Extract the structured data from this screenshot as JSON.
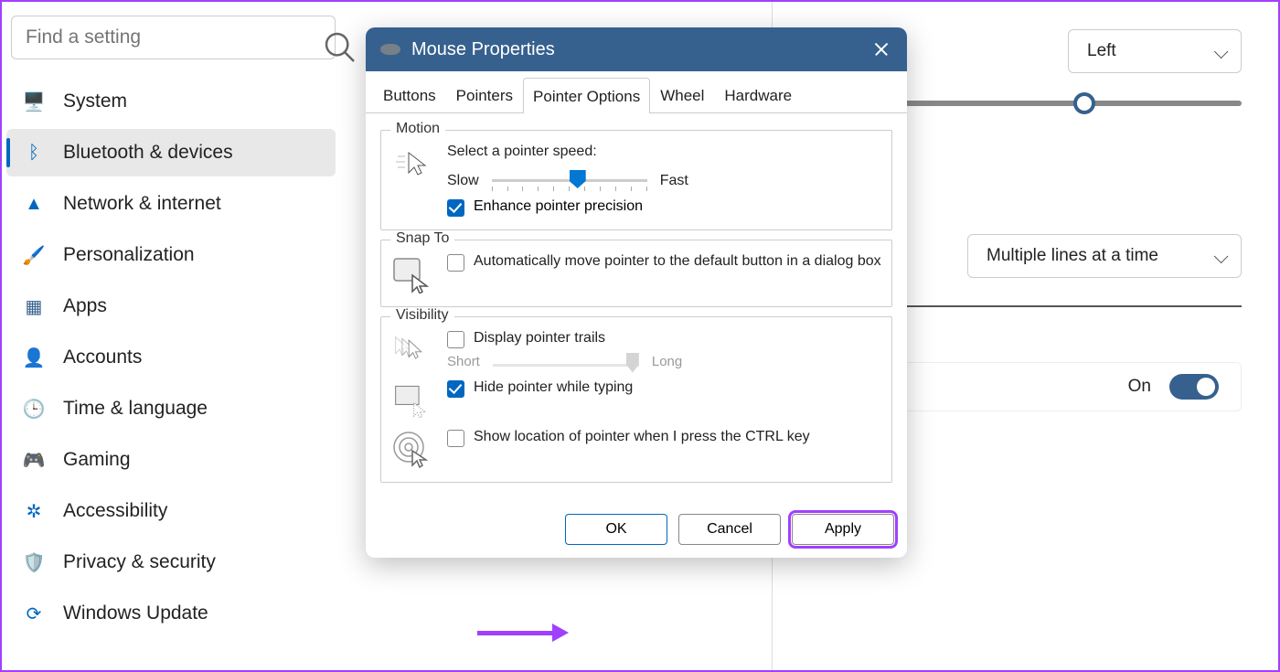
{
  "search": {
    "placeholder": "Find a setting"
  },
  "nav": [
    {
      "icon_name": "system-icon",
      "glyph": "🖥️",
      "color": "#0067c0",
      "label": "System"
    },
    {
      "icon_name": "bluetooth-icon",
      "glyph": "ᛒ",
      "color": "#0067c0",
      "label": "Bluetooth & devices",
      "active": true
    },
    {
      "icon_name": "wifi-icon",
      "glyph": "▲",
      "color": "#0067c0",
      "label": "Network & internet"
    },
    {
      "icon_name": "paintbrush-icon",
      "glyph": "🖌️",
      "color": "#d27d2d",
      "label": "Personalization"
    },
    {
      "icon_name": "apps-icon",
      "glyph": "▦",
      "color": "#36618e",
      "label": "Apps"
    },
    {
      "icon_name": "person-icon",
      "glyph": "👤",
      "color": "#2a8c6e",
      "label": "Accounts"
    },
    {
      "icon_name": "clock-icon",
      "glyph": "🕒",
      "color": "#0067c0",
      "label": "Time & language"
    },
    {
      "icon_name": "gamepad-icon",
      "glyph": "🎮",
      "color": "#888",
      "label": "Gaming"
    },
    {
      "icon_name": "accessibility-icon",
      "glyph": "✲",
      "color": "#0067c0",
      "label": "Accessibility"
    },
    {
      "icon_name": "shield-icon",
      "glyph": "🛡️",
      "color": "#888",
      "label": "Privacy & security"
    },
    {
      "icon_name": "update-icon",
      "glyph": "⟳",
      "color": "#0067c0",
      "label": "Windows Update"
    }
  ],
  "bg": {
    "primary_button_dropdown": "Left",
    "scroll_mode_dropdown": "Multiple lines at a time",
    "toggle_label": "On"
  },
  "dialog": {
    "title": "Mouse Properties",
    "tabs": [
      "Buttons",
      "Pointers",
      "Pointer Options",
      "Wheel",
      "Hardware"
    ],
    "active_tab_index": 2,
    "motion": {
      "legend": "Motion",
      "speed_label": "Select a pointer speed:",
      "slow": "Slow",
      "fast": "Fast",
      "enhance_label": "Enhance pointer precision",
      "enhance_checked": true
    },
    "snapto": {
      "legend": "Snap To",
      "label": "Automatically move pointer to the default button in a dialog box",
      "checked": false
    },
    "visibility": {
      "legend": "Visibility",
      "trails_label": "Display pointer trails",
      "trails_checked": false,
      "short": "Short",
      "long": "Long",
      "hide_typing_label": "Hide pointer while typing",
      "hide_typing_checked": true,
      "ctrl_label": "Show location of pointer when I press the CTRL key",
      "ctrl_checked": false
    },
    "buttons": {
      "ok": "OK",
      "cancel": "Cancel",
      "apply": "Apply"
    }
  }
}
